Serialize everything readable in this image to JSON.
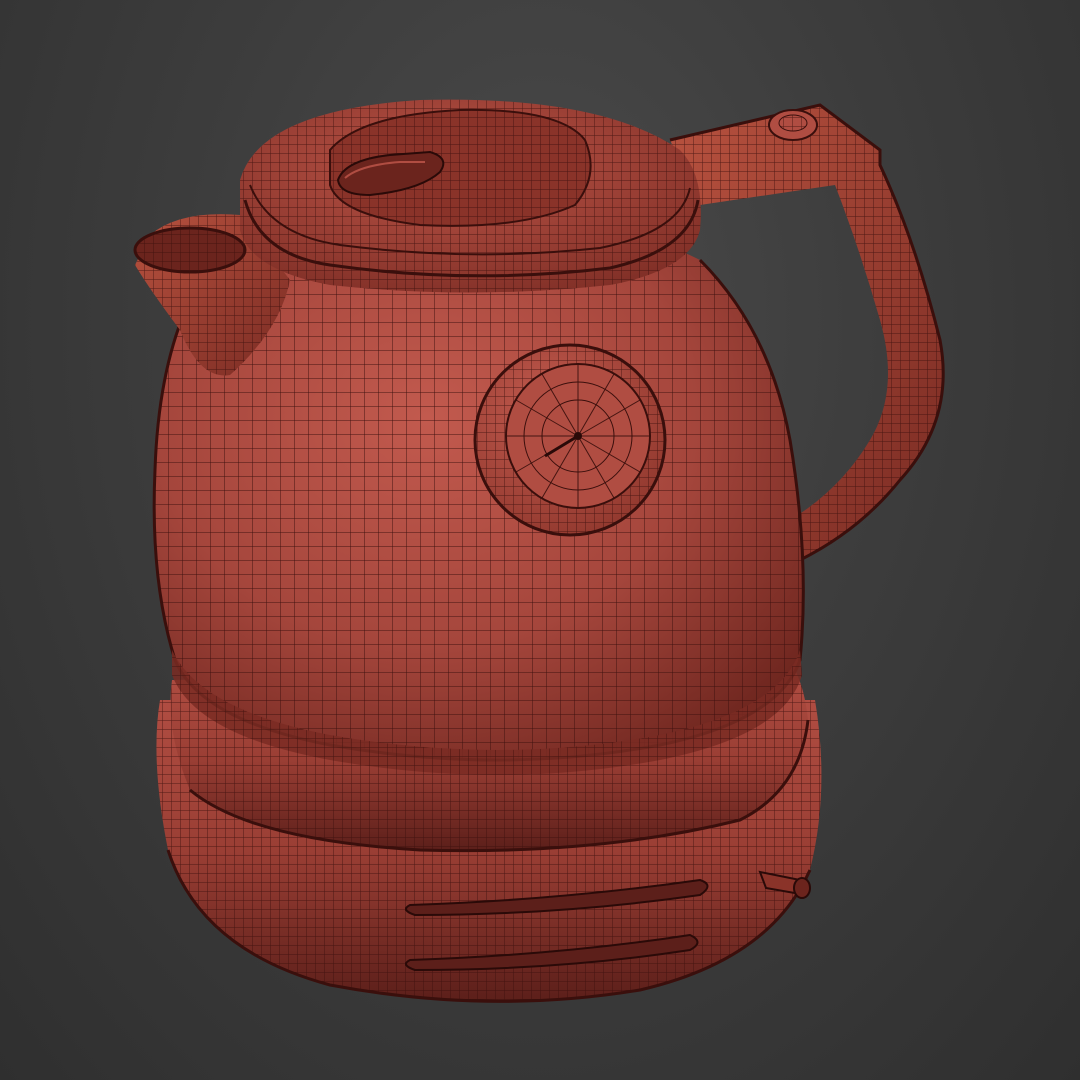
{
  "viewport": {
    "background_top": "#474747",
    "background_bottom": "#2f2f2f"
  },
  "model": {
    "object": "electric-kettle",
    "display_mode": "wireframe-on-shaded",
    "surface_color": "#a8473e",
    "surface_highlight": "#c0564a",
    "surface_shadow": "#5c1f1a",
    "wire_color": "#3a0f0c"
  },
  "parts": [
    "lid",
    "lid-handle",
    "spout",
    "body",
    "thermometer-gauge",
    "handle",
    "base-ring",
    "base",
    "switch-lever"
  ]
}
